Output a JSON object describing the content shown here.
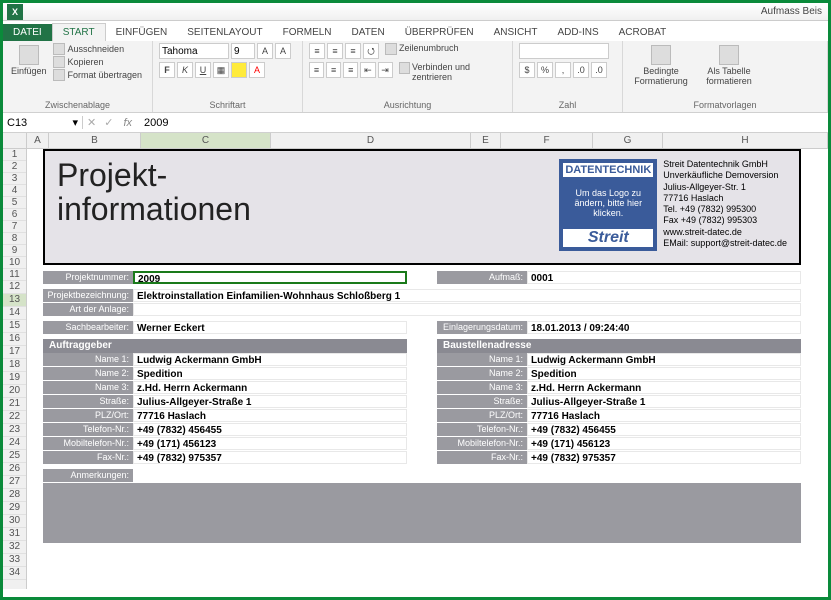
{
  "app": {
    "filename": "Aufmass Beis"
  },
  "tabs": {
    "file": "DATEI",
    "items": [
      "START",
      "EINFÜGEN",
      "SEITENLAYOUT",
      "FORMELN",
      "DATEN",
      "ÜBERPRÜFEN",
      "ANSICHT",
      "ADD-INS",
      "ACROBAT"
    ],
    "active": 0
  },
  "ribbon": {
    "clipboard": {
      "paste": "Einfügen",
      "cut": "Ausschneiden",
      "copy": "Kopieren",
      "formatp": "Format übertragen",
      "label": "Zwischenablage"
    },
    "font": {
      "name": "Tahoma",
      "size": "9",
      "label": "Schriftart"
    },
    "align": {
      "wrap": "Zeilenumbruch",
      "merge": "Verbinden und zentrieren",
      "label": "Ausrichtung"
    },
    "number": {
      "label": "Zahl"
    },
    "styles": {
      "cond": "Bedingte Formatierung",
      "table": "Als Tabelle formatieren",
      "label": "Formatvorlagen"
    }
  },
  "namebox": {
    "ref": "C13",
    "formula": "2009"
  },
  "cols": [
    "A",
    "B",
    "C",
    "D",
    "E",
    "F",
    "G",
    "H"
  ],
  "rows": [
    "1",
    "2",
    "3",
    "4",
    "5",
    "6",
    "7",
    "8",
    "9",
    "10",
    "11",
    "12",
    "13",
    "14",
    "15",
    "16",
    "17",
    "18",
    "19",
    "20",
    "21",
    "22",
    "23",
    "24",
    "25",
    "26",
    "27",
    "28",
    "29",
    "30",
    "31",
    "32",
    "33",
    "34"
  ],
  "info": {
    "title1": "Projekt-",
    "title2": "informationen",
    "logo": {
      "top": "DATENTECHNIK",
      "mid": "Um das Logo zu ändern, bitte hier klicken.",
      "brand": "Streit"
    },
    "company": {
      "l1": "Streit Datentechnik GmbH",
      "l2": "Unverkäufliche Demoversion",
      "l3": "Julius-Allgeyer-Str. 1",
      "l4": "77716 Haslach",
      "l5": "Tel. +49 (7832) 995300",
      "l6": "Fax +49 (7832) 995303",
      "l7": "www.streit-datec.de",
      "l8": "EMail: support@streit-datec.de"
    }
  },
  "fields": {
    "projektnr_l": "Projektnummer:",
    "projektnr_v": "2009",
    "aufmass_l": "Aufmaß:",
    "aufmass_v": "0001",
    "bez_l": "Projektbezeichnung:",
    "bez_v": "Elektroinstallation Einfamilien-Wohnhaus Schloßberg 1",
    "art_l": "Art der Anlage:",
    "art_v": "",
    "sach_l": "Sachbearbeiter:",
    "sach_v": "Werner Eckert",
    "einl_l": "Einlagerungsdatum:",
    "einl_v": "18.01.2013 / 09:24:40",
    "ag_hdr": "Auftraggeber",
    "bs_hdr": "Baustellenadresse",
    "n1_l": "Name 1:",
    "n2_l": "Name 2:",
    "n3_l": "Name 3:",
    "str_l": "Straße:",
    "plz_l": "PLZ/Ort:",
    "tel_l": "Telefon-Nr.:",
    "mob_l": "Mobiltelefon-Nr.:",
    "fax_l": "Fax-Nr.:",
    "ag": {
      "n1": "Ludwig Ackermann GmbH",
      "n2": "Spedition",
      "n3": "z.Hd. Herrn Ackermann",
      "str": "Julius-Allgeyer-Straße 1",
      "plz": "77716 Haslach",
      "tel": "+49 (7832) 456455",
      "mob": "+49 (171) 456123",
      "fax": "+49 (7832) 975357"
    },
    "bs": {
      "n1": "Ludwig Ackermann GmbH",
      "n2": "Spedition",
      "n3": "z.Hd. Herrn Ackermann",
      "str": "Julius-Allgeyer-Straße 1",
      "plz": "77716 Haslach",
      "tel": "+49 (7832) 456455",
      "mob": "+49 (171) 456123",
      "fax": "+49 (7832) 975357"
    },
    "anm_l": "Anmerkungen:"
  }
}
